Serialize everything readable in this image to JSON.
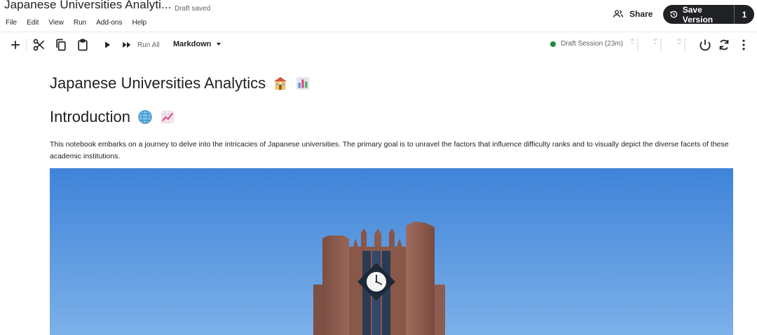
{
  "header": {
    "title": "Japanese Universities Analyti...",
    "draft_status": "Draft saved",
    "menu": [
      "File",
      "Edit",
      "View",
      "Run",
      "Add-ons",
      "Help"
    ],
    "share_label": "Share",
    "save_version_label": "Save Version",
    "save_version_count": "1"
  },
  "toolbar": {
    "icons": [
      "add-cell-icon",
      "cut-icon",
      "copy-icon",
      "paste-icon",
      "run-cell-icon",
      "run-all-icon"
    ],
    "run_all_label": "Run All",
    "cell_type": "Markdown",
    "session_label": "Draft Session (23m)",
    "session_status_color": "#1e8e3e",
    "meters": [
      {
        "label": "HDD"
      },
      {
        "label": "CPU"
      },
      {
        "label": "RAM"
      }
    ],
    "right_icons": [
      "power-icon",
      "restart-icon",
      "more-vert-icon"
    ]
  },
  "content": {
    "heading1": "Japanese Universities Analytics",
    "heading1_emojis": [
      "school-emoji",
      "bar-chart-emoji"
    ],
    "heading2": "Introduction",
    "heading2_emojis": [
      "globe-emoji",
      "chart-increasing-emoji"
    ],
    "intro_text": "This notebook embarks on a journey to delve into the intricacies of Japanese universities. The primary goal is to unravel the factors that influence difficulty ranks and to visually depict the diverse facets of these academic institutions.",
    "image_subject": "clock-tower-building-photo"
  },
  "colors": {
    "accent_dark": "#202124",
    "sky": "#4d8fdc",
    "brick": "#8a5a4e"
  }
}
